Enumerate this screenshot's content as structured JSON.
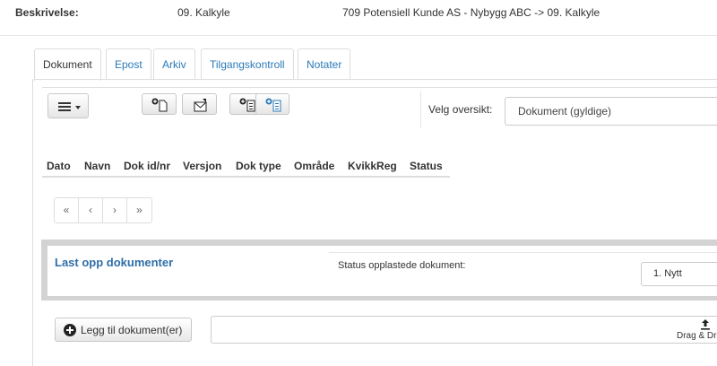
{
  "header": {
    "label": "Beskrivelse:",
    "value": "09. Kalkyle",
    "path": "709 Potensiell Kunde AS - Nybygg ABC -> 09. Kalkyle"
  },
  "tabs": [
    {
      "label": "Dokument",
      "active": true
    },
    {
      "label": "Epost",
      "active": false
    },
    {
      "label": "Arkiv",
      "active": false
    },
    {
      "label": "Tilgangskontroll",
      "active": false
    },
    {
      "label": "Notater",
      "active": false
    }
  ],
  "toolbar": {
    "overview_label": "Velg oversikt:",
    "overview_value": "Dokument (gyldige)"
  },
  "table": {
    "columns": [
      "Dato",
      "Navn",
      "Dok id/nr",
      "Versjon",
      "Dok type",
      "Område",
      "KvikkReg",
      "Status"
    ]
  },
  "pager": [
    "«",
    "‹",
    "›",
    "»"
  ],
  "upload": {
    "title": "Last opp dokumenter",
    "status_label": "Status opplastede dokument:",
    "status_value": "1. Nytt",
    "add_button": "Legg til dokument(er)",
    "drop_text": "Drag & Drop"
  },
  "colors": {
    "link": "#2a7ab8",
    "upload_title": "#2f6fa8",
    "panel_border": "#d3d3d3"
  }
}
